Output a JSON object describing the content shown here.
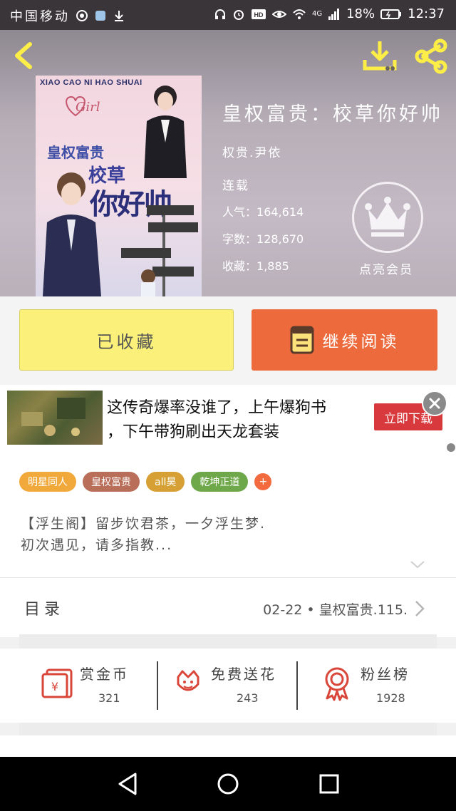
{
  "status_bar": {
    "carrier": "中国移动",
    "network": "4G",
    "battery": "18%",
    "time": "12:37"
  },
  "book": {
    "title": "皇权富贵：校草你好帅",
    "author": "权贵.尹依",
    "status": "连载",
    "popularity_label": "人气：",
    "popularity": "164,614",
    "words_label": "字数：",
    "words": "128,670",
    "favorites_label": "收藏：",
    "favorites": "1,885",
    "cover": {
      "top_text": "XIAO CAO NI HAO SHUAI",
      "girl_text": "Girl",
      "line1": "皇权富贵",
      "line2": "校草",
      "line3": "你好帅"
    }
  },
  "vip": {
    "label": "点亮会员"
  },
  "actions": {
    "collected_label": "已收藏",
    "read_label": "继续阅读"
  },
  "ad": {
    "line1": "这传奇爆率没谁了，上午爆狗书",
    "line2": "，下午带狗刷出天龙套装",
    "button_label": "立即下载"
  },
  "tags": [
    {
      "label": "明星同人",
      "color": "#f2a93b"
    },
    {
      "label": "皇权富贵",
      "color": "#b86e58"
    },
    {
      "label": "all昊",
      "color": "#d6a034"
    },
    {
      "label": "乾坤正道",
      "color": "#6fa84a"
    }
  ],
  "tag_add_label": "+",
  "intro": {
    "line1": "【浮生阁】留步饮君茶，一夕浮生梦.",
    "line2": "初次遇见，请多指教..."
  },
  "catalog": {
    "label": "目录",
    "latest": "02-22 • 皇权富贵.115."
  },
  "stats": [
    {
      "name": "赏金币",
      "value": "321",
      "icon": "red-envelope-icon"
    },
    {
      "name": "免费送花",
      "value": "243",
      "icon": "flower-icon"
    },
    {
      "name": "粉丝榜",
      "value": "1928",
      "icon": "medal-icon"
    }
  ],
  "colors": {
    "accent": "#ec6a3b",
    "collected_bg": "#fbf17a",
    "icon_red": "#d9463a"
  }
}
